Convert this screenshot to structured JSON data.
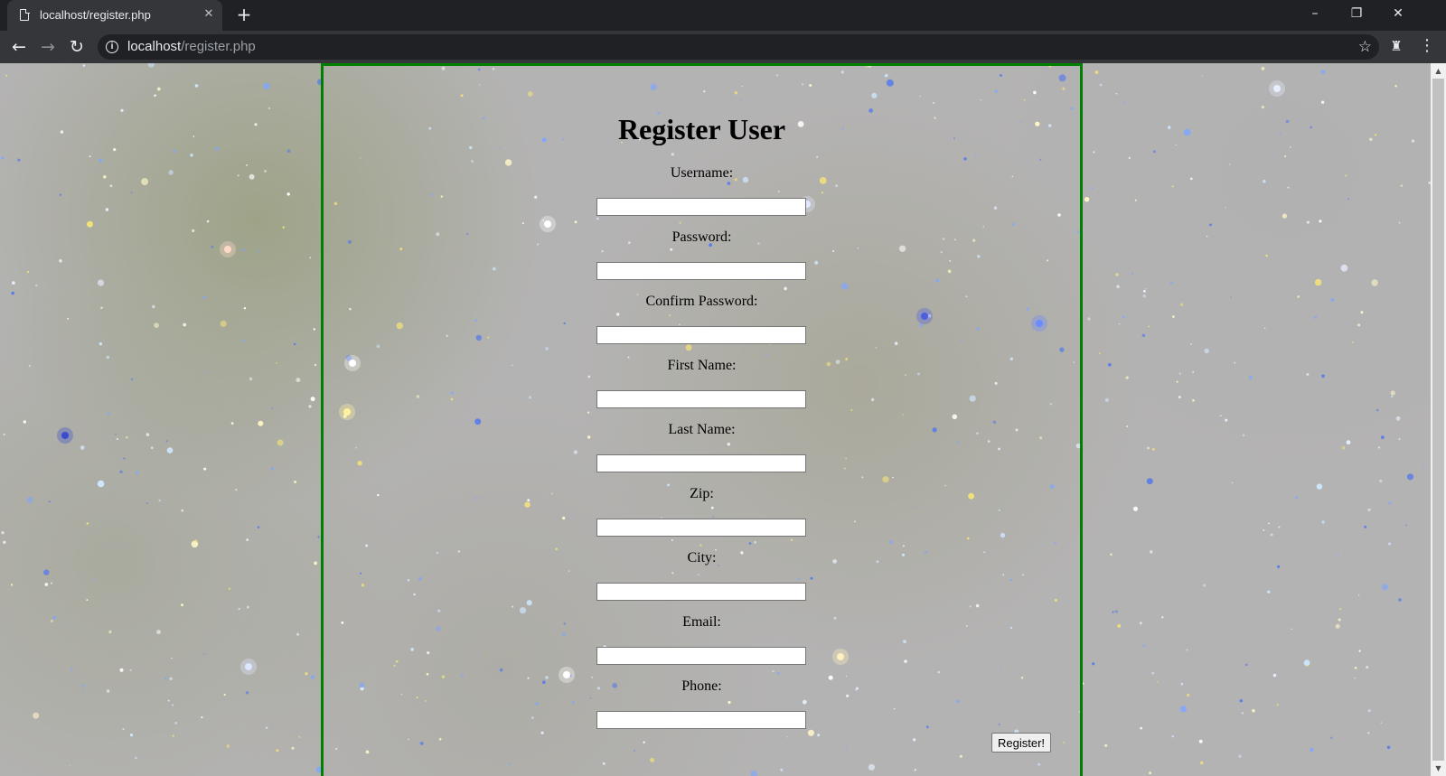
{
  "browser": {
    "tab_title": "localhost/register.php",
    "tab_close_icon": "close-icon",
    "new_tab_symbol": "+",
    "url_host": "localhost",
    "url_path": "/register.php",
    "nav": {
      "back": "←",
      "forward": "→",
      "reload": "↻"
    },
    "window_controls": {
      "minimize": "–",
      "restore": "❐",
      "close": "✕"
    },
    "bookmark_star": "☆",
    "menu": "⋮"
  },
  "page": {
    "title": "Register User",
    "border_color": "#008000",
    "fields": [
      {
        "label": "Username:",
        "value": ""
      },
      {
        "label": "Password:",
        "value": ""
      },
      {
        "label": "Confirm Password:",
        "value": ""
      },
      {
        "label": "First Name:",
        "value": ""
      },
      {
        "label": "Last Name:",
        "value": ""
      },
      {
        "label": "Zip:",
        "value": ""
      },
      {
        "label": "City:",
        "value": ""
      },
      {
        "label": "Email:",
        "value": ""
      },
      {
        "label": "Phone:",
        "value": ""
      }
    ],
    "submit_label": "Register!"
  }
}
